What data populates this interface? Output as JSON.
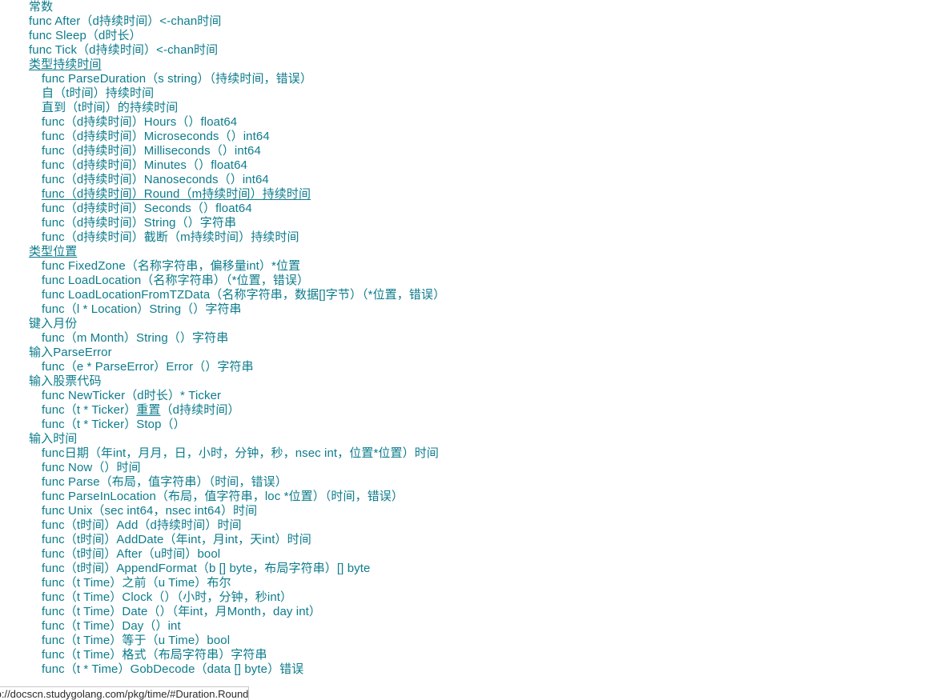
{
  "page": {
    "title": "time - Go 语言标准库索引",
    "link_color": "#0d7c8c",
    "background_color": "#ffffff",
    "status_text_color": "#2b2b2b"
  },
  "status_bar": {
    "url": "tp://docscn.studygolang.com/pkg/time/#Duration.Round"
  },
  "index": {
    "rows": [
      {
        "label": "常数",
        "level": 0,
        "kind": "header",
        "underline": false,
        "hover": false
      },
      {
        "label": "func After（d持续时间）<-chan时间",
        "level": 0,
        "kind": "func",
        "underline": false,
        "hover": false
      },
      {
        "label": "func Sleep（d时长）",
        "level": 0,
        "kind": "func",
        "underline": false,
        "hover": false
      },
      {
        "label": "func Tick（d持续时间）<-chan时间",
        "level": 0,
        "kind": "func",
        "underline": false,
        "hover": false
      },
      {
        "label": "类型持续时间",
        "level": 0,
        "kind": "header",
        "underline": true,
        "hover": false
      },
      {
        "label": "func ParseDuration（s string）（持续时间，错误）",
        "level": 1,
        "kind": "func",
        "underline": false,
        "hover": false
      },
      {
        "label": "自（t时间）持续时间",
        "level": 1,
        "kind": "func",
        "underline": false,
        "hover": false
      },
      {
        "label": "直到（t时间）的持续时间",
        "level": 1,
        "kind": "func",
        "underline": false,
        "hover": false
      },
      {
        "label": "func（d持续时间）Hours（）float64",
        "level": 1,
        "kind": "func",
        "underline": false,
        "hover": false
      },
      {
        "label": "func（d持续时间）Microseconds（）int64",
        "level": 1,
        "kind": "func",
        "underline": false,
        "hover": false
      },
      {
        "label": "func（d持续时间）Milliseconds（）int64",
        "level": 1,
        "kind": "func",
        "underline": false,
        "hover": false
      },
      {
        "label": "func（d持续时间）Minutes（）float64",
        "level": 1,
        "kind": "func",
        "underline": false,
        "hover": false
      },
      {
        "label": "func（d持续时间）Nanoseconds（）int64",
        "level": 1,
        "kind": "func",
        "underline": false,
        "hover": false
      },
      {
        "label": "func（d持续时间）Round（m持续时间）持续时间",
        "level": 1,
        "kind": "func",
        "underline": false,
        "hover": true
      },
      {
        "label": "func（d持续时间）Seconds（）float64",
        "level": 1,
        "kind": "func",
        "underline": false,
        "hover": false
      },
      {
        "label": "func（d持续时间）String（）字符串",
        "level": 1,
        "kind": "func",
        "underline": false,
        "hover": false
      },
      {
        "label": "func（d持续时间）截断（m持续时间）持续时间",
        "level": 1,
        "kind": "func",
        "underline": false,
        "hover": false
      },
      {
        "label": "类型位置",
        "level": 0,
        "kind": "header",
        "underline": true,
        "hover": false
      },
      {
        "label": "func FixedZone（名称字符串，偏移量int）*位置",
        "level": 1,
        "kind": "func",
        "underline": false,
        "hover": false
      },
      {
        "label": "func LoadLocation（名称字符串）（*位置，错误）",
        "level": 1,
        "kind": "func",
        "underline": false,
        "hover": false
      },
      {
        "label": "func LoadLocationFromTZData（名称字符串，数据[]字节）（*位置，错误）",
        "level": 1,
        "kind": "func",
        "underline": false,
        "hover": false
      },
      {
        "label": "func（l * Location）String（）字符串",
        "level": 1,
        "kind": "func",
        "underline": false,
        "hover": false
      },
      {
        "label": "键入月份",
        "level": 0,
        "kind": "header",
        "underline": false,
        "hover": false
      },
      {
        "label": "func（m Month）String（）字符串",
        "level": 1,
        "kind": "func",
        "underline": false,
        "hover": false
      },
      {
        "label": "输入ParseError",
        "level": 0,
        "kind": "header",
        "underline": false,
        "hover": false
      },
      {
        "label": "func（e * ParseError）Error（）字符串",
        "level": 1,
        "kind": "func",
        "underline": false,
        "hover": false
      },
      {
        "label": "输入股票代码",
        "level": 0,
        "kind": "header",
        "underline": false,
        "hover": false
      },
      {
        "label": "func NewTicker（d时长）* Ticker",
        "level": 1,
        "kind": "func",
        "underline": false,
        "hover": false
      },
      {
        "label": "func（t * Ticker）重置（d持续时间）",
        "level": 1,
        "kind": "func",
        "underline": false,
        "hover": false,
        "inline_underline": "重置"
      },
      {
        "label": "func（t * Ticker）Stop（）",
        "level": 1,
        "kind": "func",
        "underline": false,
        "hover": false
      },
      {
        "label": "输入时间",
        "level": 0,
        "kind": "header",
        "underline": false,
        "hover": false
      },
      {
        "label": "func日期（年int，月月，日，小时，分钟，秒，nsec int，位置*位置）时间",
        "level": 1,
        "kind": "func",
        "underline": false,
        "hover": false
      },
      {
        "label": "func Now（）时间",
        "level": 1,
        "kind": "func",
        "underline": false,
        "hover": false
      },
      {
        "label": "func Parse（布局，值字符串）（时间，错误）",
        "level": 1,
        "kind": "func",
        "underline": false,
        "hover": false
      },
      {
        "label": "func ParseInLocation（布局，值字符串，loc *位置）（时间，错误）",
        "level": 1,
        "kind": "func",
        "underline": false,
        "hover": false
      },
      {
        "label": "func Unix（sec int64，nsec int64）时间",
        "level": 1,
        "kind": "func",
        "underline": false,
        "hover": false
      },
      {
        "label": "func（t时间）Add（d持续时间）时间",
        "level": 1,
        "kind": "func",
        "underline": false,
        "hover": false
      },
      {
        "label": "func（t时间）AddDate（年int，月int，天int）时间",
        "level": 1,
        "kind": "func",
        "underline": false,
        "hover": false
      },
      {
        "label": "func（t时间）After（u时间）bool",
        "level": 1,
        "kind": "func",
        "underline": false,
        "hover": false
      },
      {
        "label": "func（t时间）AppendFormat（b [] byte，布局字符串）[] byte",
        "level": 1,
        "kind": "func",
        "underline": false,
        "hover": false
      },
      {
        "label": "func（t Time）之前（u Time）布尔",
        "level": 1,
        "kind": "func",
        "underline": false,
        "hover": false
      },
      {
        "label": "func（t Time）Clock（）（小时，分钟，秒int）",
        "level": 1,
        "kind": "func",
        "underline": false,
        "hover": false
      },
      {
        "label": "func（t Time）Date（）（年int，月Month，day int）",
        "level": 1,
        "kind": "func",
        "underline": false,
        "hover": false
      },
      {
        "label": "func（t Time）Day（）int",
        "level": 1,
        "kind": "func",
        "underline": false,
        "hover": false
      },
      {
        "label": "func（t Time）等于（u Time）bool",
        "level": 1,
        "kind": "func",
        "underline": false,
        "hover": false
      },
      {
        "label": "func（t Time）格式（布局字符串）字符串",
        "level": 1,
        "kind": "func",
        "underline": false,
        "hover": false
      },
      {
        "label": "func（t * Time）GobDecode（data [] byte）错误",
        "level": 1,
        "kind": "func",
        "underline": false,
        "hover": false,
        "clipped": true
      }
    ]
  }
}
